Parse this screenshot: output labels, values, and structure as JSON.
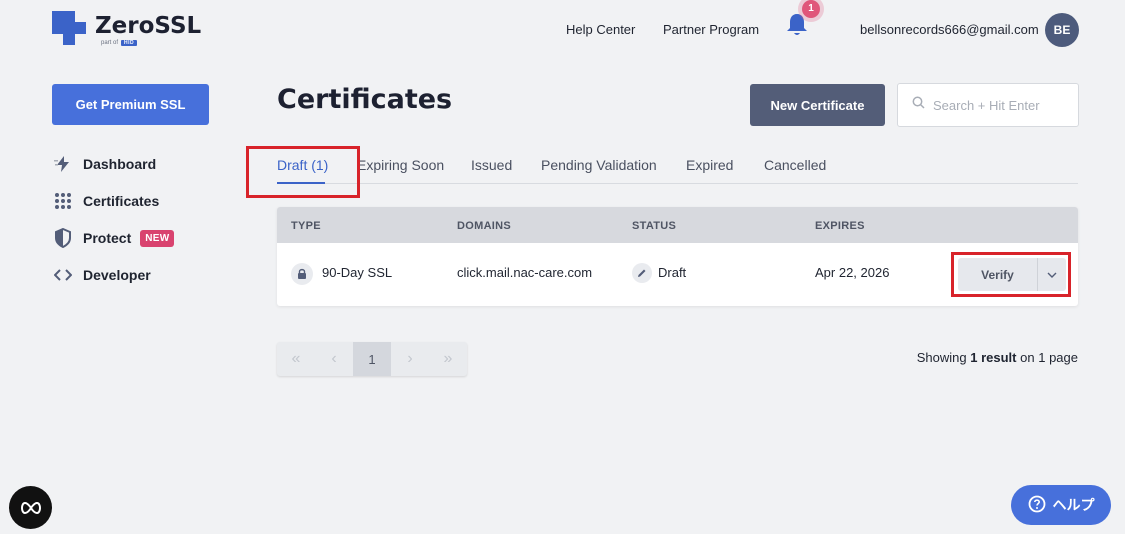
{
  "brand": {
    "name": "ZeroSSL",
    "sub_prefix": "part of",
    "sub_badge": "HID",
    "accent": "#4770db"
  },
  "topnav": {
    "help_center": "Help Center",
    "partner_program": "Partner Program",
    "notification_count": "1",
    "user_email": "bellsonrecords666@gmail.com",
    "avatar_initials": "BE"
  },
  "sidebar": {
    "premium_label": "Get Premium SSL",
    "items": [
      {
        "label": "Dashboard",
        "icon": "bolt-icon"
      },
      {
        "label": "Certificates",
        "icon": "grid-dots-icon"
      },
      {
        "label": "Protect",
        "icon": "shield-icon",
        "badge": "NEW"
      },
      {
        "label": "Developer",
        "icon": "code-brackets-icon"
      }
    ]
  },
  "main": {
    "title": "Certificates",
    "new_certificate_label": "New Certificate",
    "search_placeholder": "Search + Hit Enter",
    "tabs": [
      {
        "label": "Draft (1)",
        "active": true
      },
      {
        "label": "Expiring Soon"
      },
      {
        "label": "Issued"
      },
      {
        "label": "Pending Validation"
      },
      {
        "label": "Expired"
      },
      {
        "label": "Cancelled"
      }
    ],
    "table": {
      "headers": [
        "TYPE",
        "DOMAINS",
        "STATUS",
        "EXPIRES"
      ],
      "rows": [
        {
          "type": "90-Day SSL",
          "domain": "click.mail.nac-care.com",
          "status": "Draft",
          "expires": "Apr 22, 2026",
          "action": "Verify"
        }
      ]
    },
    "pagination": {
      "current_page": "1",
      "showing_prefix": "Showing",
      "showing_count": "1 result",
      "showing_mid": "on",
      "showing_pages": "1",
      "showing_suffix": "page"
    }
  },
  "floating": {
    "help_label": "ヘルプ"
  }
}
